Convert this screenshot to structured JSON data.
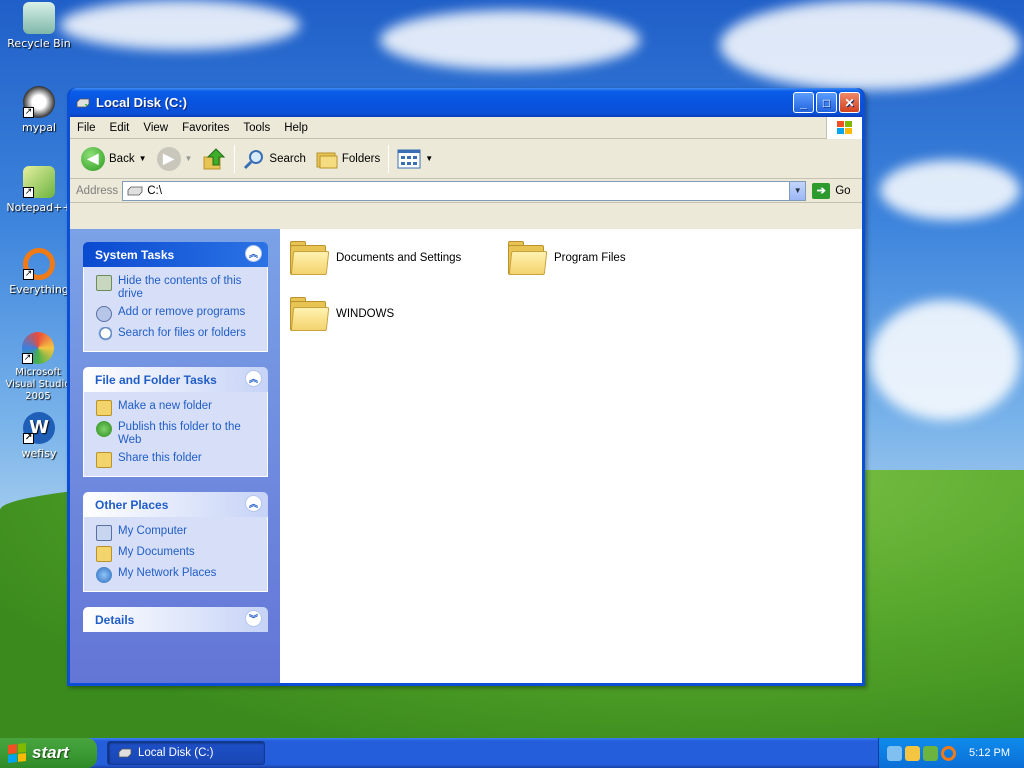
{
  "desktop": {
    "icons": [
      {
        "label": "Recycle Bin",
        "icon": "recycle-bin-icon"
      },
      {
        "label": "mypal",
        "icon": "mypal-icon"
      },
      {
        "label": "Notepad++",
        "icon": "notepadpp-icon"
      },
      {
        "label": "Everything",
        "icon": "everything-icon"
      },
      {
        "label": "Microsoft Visual Studio 2005",
        "icon": "visual-studio-icon"
      },
      {
        "label": "wefisy",
        "icon": "wefisy-icon"
      }
    ]
  },
  "window": {
    "title": "Local Disk (C:)",
    "menu": [
      "File",
      "Edit",
      "View",
      "Favorites",
      "Tools",
      "Help"
    ],
    "toolbar": {
      "back": "Back",
      "search": "Search",
      "folders": "Folders"
    },
    "address": {
      "label": "Address",
      "value": "C:\\",
      "go": "Go"
    },
    "panels": {
      "system_tasks": {
        "title": "System Tasks",
        "items": [
          "Hide the contents of this drive",
          "Add or remove programs",
          "Search for files or folders"
        ]
      },
      "file_folder_tasks": {
        "title": "File and Folder Tasks",
        "items": [
          "Make a new folder",
          "Publish this folder to the Web",
          "Share this folder"
        ]
      },
      "other_places": {
        "title": "Other Places",
        "items": [
          "My Computer",
          "My Documents",
          "My Network Places"
        ]
      },
      "details": {
        "title": "Details"
      }
    },
    "files": [
      "Documents and Settings",
      "Program Files",
      "WINDOWS"
    ]
  },
  "taskbar": {
    "start": "start",
    "task_button": "Local Disk (C:)",
    "clock": "5:12 PM"
  }
}
